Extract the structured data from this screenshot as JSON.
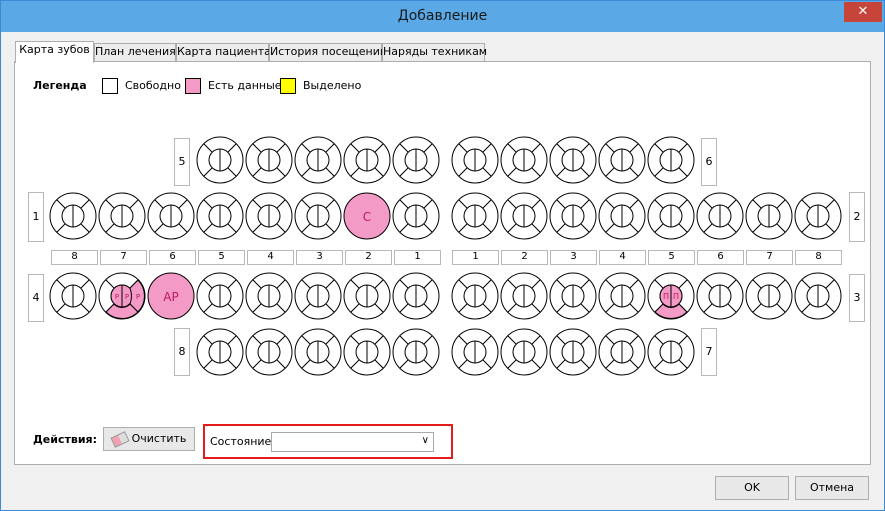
{
  "window": {
    "title": "Добавление",
    "close_icon": "close-icon"
  },
  "tabs": [
    {
      "label": "Карта зубов",
      "active": true
    },
    {
      "label": "План лечения",
      "active": false
    },
    {
      "label": "Карта пациента",
      "active": false
    },
    {
      "label": "История посещений",
      "active": false
    },
    {
      "label": "Наряды техникам",
      "active": false
    }
  ],
  "legend": {
    "title": "Легенда",
    "items": [
      {
        "label": "Свободно",
        "color": "#ffffff"
      },
      {
        "label": "Есть данные",
        "color": "#f49ac6"
      },
      {
        "label": "Выделено",
        "color": "#ffff00"
      }
    ]
  },
  "quadrants": {
    "q1": "1",
    "q2": "2",
    "q3": "3",
    "q4": "4",
    "q5": "5",
    "q6": "6",
    "q7": "7",
    "q8": "8"
  },
  "tooth_numbers": {
    "left": [
      "8",
      "7",
      "6",
      "5",
      "4",
      "3",
      "2",
      "1"
    ],
    "right": [
      "1",
      "2",
      "3",
      "4",
      "5",
      "6",
      "7",
      "8"
    ]
  },
  "marked_teeth": {
    "upper_left_2": {
      "label": "С"
    },
    "lower_left_6": {
      "label": "AP"
    },
    "lower_left_7": {
      "labels": [
        "Р",
        "Р",
        "Р"
      ]
    },
    "lower_right_5": {
      "labels": [
        "П",
        "П"
      ]
    }
  },
  "colors": {
    "marked": "#f49ac6",
    "marked_text": "#c0185e",
    "selection_border": "#e51c1c"
  },
  "actions": {
    "label": "Действия:",
    "clear_button": "Очистить",
    "clear_icon": "eraser-icon",
    "state_label": "Состояние",
    "state_value": "",
    "dropdown_icon": "chevron-down-icon"
  },
  "footer": {
    "ok": "OK",
    "cancel": "Отмена"
  }
}
